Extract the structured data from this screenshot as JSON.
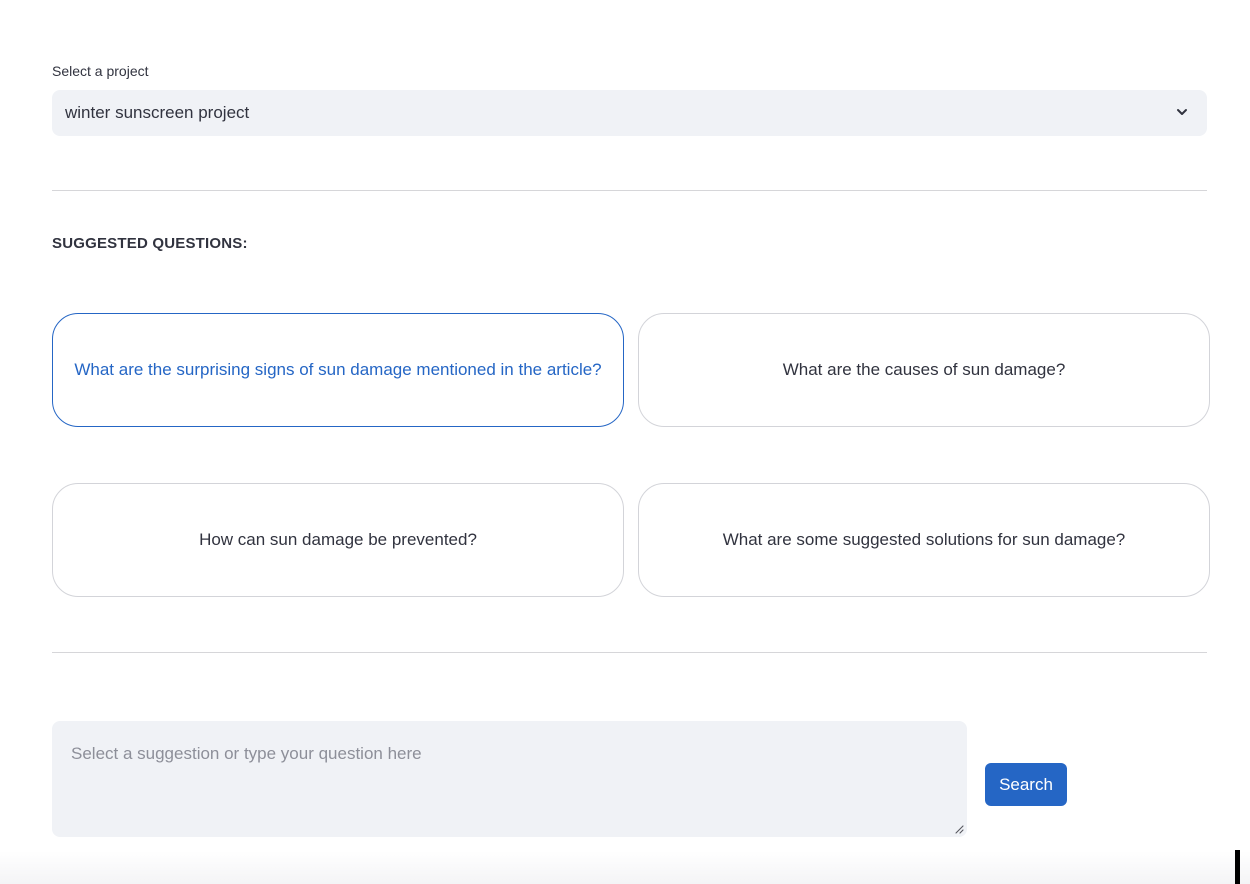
{
  "project_select": {
    "label": "Select a project",
    "selected_value": "winter sunscreen project",
    "icon": "chevron-down-icon"
  },
  "suggested": {
    "title": "SUGGESTED QUESTIONS:",
    "questions": [
      "What are the surprising signs of sun damage mentioned in the article?",
      "What are the causes of sun damage?",
      "How can sun damage be prevented?",
      "What are some suggested solutions for sun damage?"
    ],
    "active_index": 0
  },
  "query": {
    "placeholder": "Select a suggestion or type your question here",
    "value": ""
  },
  "search_button": {
    "label": "Search"
  },
  "colors": {
    "accent": "#2566c5",
    "input_bg": "#f0f2f6",
    "text": "#31333f",
    "placeholder": "#8d8f99",
    "border": "#d3d4d9"
  }
}
